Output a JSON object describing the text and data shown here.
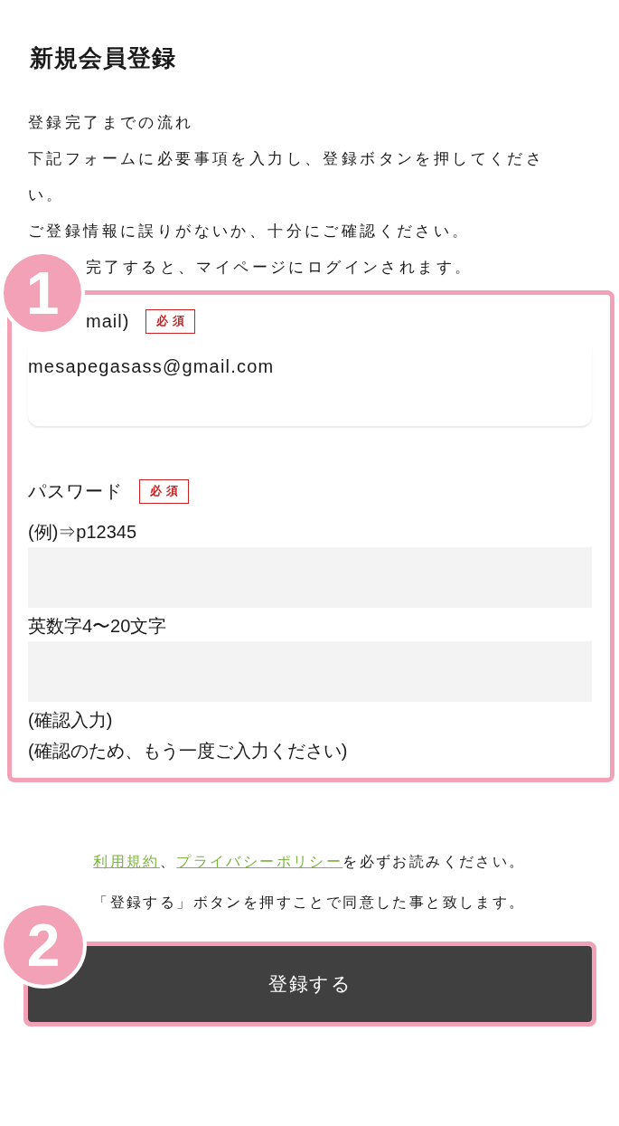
{
  "page_title": "新規会員登録",
  "intro": {
    "lines": [
      "登録完了までの流れ",
      "下記フォームに必要事項を入力し、登録ボタンを押してください。",
      "ご登録情報に誤りがないか、十分にご確認ください。",
      "完了すると、マイページにログインされます。"
    ]
  },
  "form": {
    "step": "1",
    "email": {
      "label": "mail)",
      "required_tag": "必須",
      "value": "mesapegasass@gmail.com"
    },
    "password": {
      "label": "パスワード",
      "required_tag": "必須",
      "items": [
        {
          "kind": "note",
          "text": "(例)⇒p12345"
        },
        {
          "kind": "input"
        },
        {
          "kind": "note",
          "text": "英数字4〜20文字"
        },
        {
          "kind": "input"
        },
        {
          "kind": "note",
          "text": "(確認入力)"
        },
        {
          "kind": "note",
          "text": "(確認のため、もう一度ご入力ください)"
        }
      ]
    }
  },
  "terms": {
    "lines": [
      {
        "parts": [
          {
            "kind": "link",
            "text": "利用規約"
          },
          {
            "kind": "text",
            "text": "、"
          },
          {
            "kind": "link",
            "text": "プライバシーポリシー"
          },
          {
            "kind": "text",
            "text": "を必ずお読みください。"
          }
        ]
      },
      {
        "parts": [
          {
            "kind": "text",
            "text": "「登録する」ボタンを押すことで同意した事と致します。"
          }
        ]
      }
    ]
  },
  "submit": {
    "step": "2",
    "label": "登録する"
  }
}
